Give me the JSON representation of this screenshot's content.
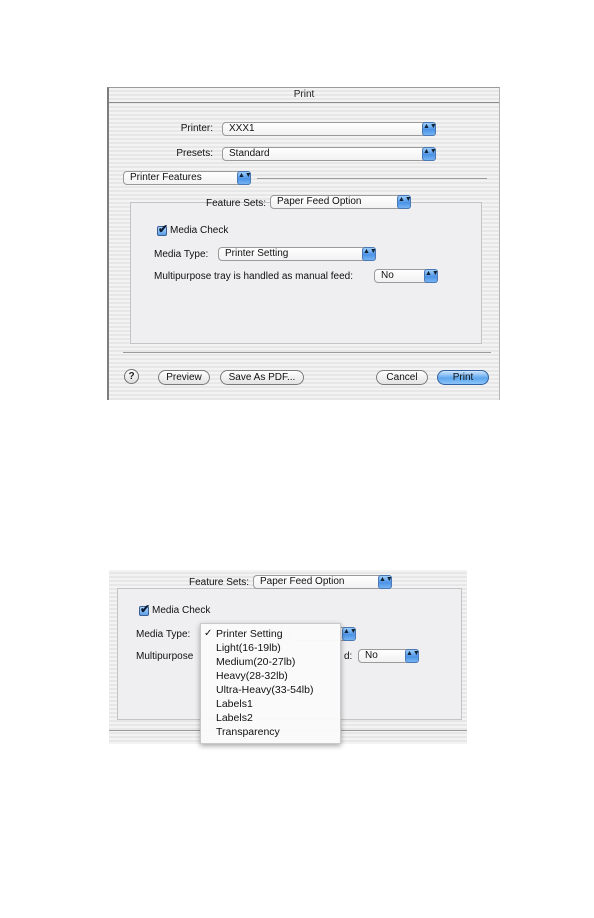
{
  "dialog1": {
    "title": "Print",
    "printer_label": "Printer:",
    "printer_value": "XXX1",
    "presets_label": "Presets:",
    "presets_value": "Standard",
    "pane_selector_value": "Printer Features",
    "feature_sets_label": "Feature Sets:",
    "feature_sets_value": "Paper Feed Option",
    "media_check_label": "Media Check",
    "media_check_checked": true,
    "media_type_label": "Media Type:",
    "media_type_value": "Printer Setting",
    "manual_feed_label": "Multipurpose tray is handled as manual feed:",
    "manual_feed_value": "No",
    "buttons": {
      "help": "?",
      "preview": "Preview",
      "save_as_pdf": "Save As PDF...",
      "cancel": "Cancel",
      "print": "Print"
    }
  },
  "dialog2": {
    "feature_sets_label": "Feature Sets:",
    "feature_sets_value": "Paper Feed Option",
    "media_check_label": "Media Check",
    "media_check_checked": true,
    "media_type_label": "Media Type:",
    "manual_feed_label_visible": "Multipurpose",
    "manual_feed_label_tail": "d:",
    "manual_feed_value": "No",
    "media_type_menu": {
      "checkmark": "✓",
      "selected_index": 0,
      "items": [
        "Printer Setting",
        "Light(16-19lb)",
        "Medium(20-27lb)",
        "Heavy(28-32lb)",
        "Ultra-Heavy(33-54lb)",
        "Labels1",
        "Labels2",
        "Transparency"
      ]
    }
  },
  "icons": {
    "popup_arrows": "▲▼",
    "checkmark": "✔"
  }
}
